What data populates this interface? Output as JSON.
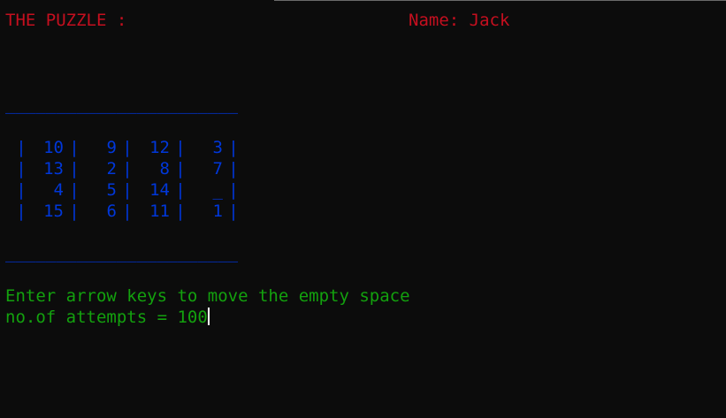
{
  "header": {
    "title": "THE PUZZLE :",
    "name": "Name: Jack"
  },
  "separator": "_______________________",
  "board": [
    [
      "10",
      "9",
      "12",
      "3"
    ],
    [
      "13",
      "2",
      "8",
      "7"
    ],
    [
      "4",
      "5",
      "14",
      "_"
    ],
    [
      "15",
      "6",
      "11",
      "1"
    ]
  ],
  "instructions": "Enter arrow keys to move the empty space",
  "attempts": "no.of attempts = 100",
  "colors": {
    "background": "#0c0c0c",
    "header": "#c50f1f",
    "board": "#0037da",
    "message": "#13a10e"
  }
}
